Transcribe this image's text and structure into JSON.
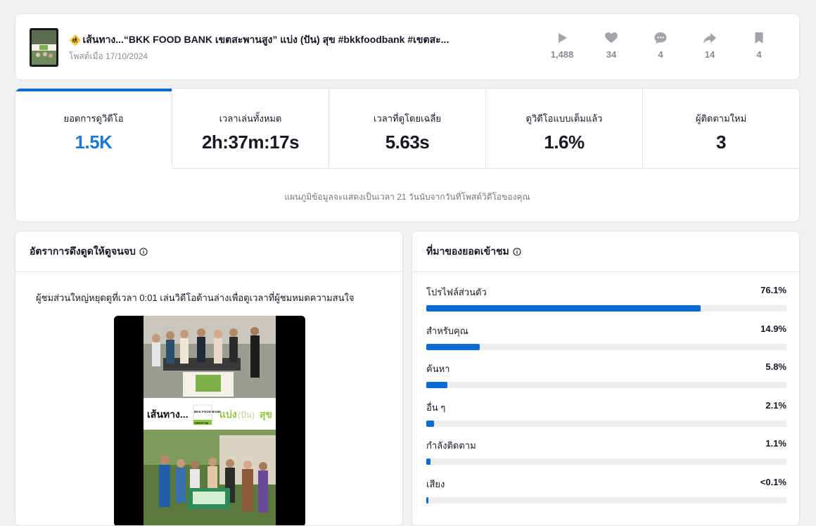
{
  "post": {
    "title_emoji": "🚸",
    "title": "เส้นทาง...“BKK FOOD BANK เขตสะพานสูง” แบ่ง (ปัน) สุข #bkkfoodbank #เขตสะ...",
    "date": "โพสต์เมื่อ 17/10/2024",
    "stats": {
      "views": "1,488",
      "likes": "34",
      "comments": "4",
      "shares": "14",
      "saves": "4"
    },
    "icons": [
      "play-icon",
      "heart-icon",
      "comment-icon",
      "share-icon",
      "bookmark-icon"
    ]
  },
  "metrics": {
    "tabs": [
      {
        "label": "ยอดการดูวิดีโอ",
        "value": "1.5K"
      },
      {
        "label": "เวลาเล่นทั้งหมด",
        "value": "2h:37m:17s"
      },
      {
        "label": "เวลาที่ดูโดยเฉลี่ย",
        "value": "5.63s"
      },
      {
        "label": "ดูวิดีโอแบบเต็มแล้ว",
        "value": "1.6%"
      },
      {
        "label": "ผู้ติดตามใหม่",
        "value": "3"
      }
    ],
    "note": "แผนภูมิข้อมูลจะแสดงเป็นเวลา 21 วันนับจากวันที่โพสต์วิดีโอของคุณ"
  },
  "retention": {
    "title": "อัตราการดึงดูดให้ดูจนจบ",
    "description": "ผู้ชมส่วนใหญ่หยุดดูที่เวลา 0:01 เล่นวิดีโอด้านล่างเพื่อดูเวลาที่ผู้ชมหมดความสนใจ",
    "video_overlay": {
      "prefix": "เส้นทาง...",
      "logo": "BKK FOOD BANK",
      "logo_sub": "เขตสะพานสูง",
      "share_text": "แบ่ง",
      "paren_text": "(ปัน)",
      "happy_text": "สุข"
    }
  },
  "traffic": {
    "title": "ที่มาของยอดเข้าชม",
    "accent": "#0b6bd4",
    "sources": [
      {
        "label": "โปรไฟล์ส่วนตัว",
        "pct": "76.1%",
        "value": 76.1
      },
      {
        "label": "สำหรับคุณ",
        "pct": "14.9%",
        "value": 14.9
      },
      {
        "label": "ค้นหา",
        "pct": "5.8%",
        "value": 5.8
      },
      {
        "label": "อื่น ๆ",
        "pct": "2.1%",
        "value": 2.1
      },
      {
        "label": "กำลังติดตาม",
        "pct": "1.1%",
        "value": 1.1
      },
      {
        "label": "เสียง",
        "pct": "<0.1%",
        "value": 0.05
      }
    ]
  }
}
